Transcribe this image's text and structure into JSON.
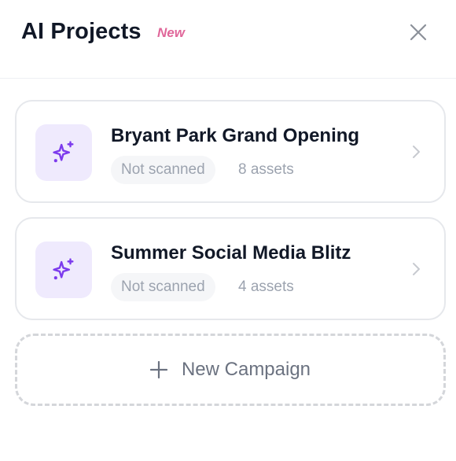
{
  "header": {
    "title": "AI Projects",
    "badge": "New",
    "close_icon": "close-icon"
  },
  "projects": [
    {
      "title": "Bryant Park Grand Opening",
      "status": "Not scanned",
      "assets": "8 assets",
      "icon": "sparkles-icon"
    },
    {
      "title": "Summer Social Media Blitz",
      "status": "Not scanned",
      "assets": "4 assets",
      "icon": "sparkles-icon"
    }
  ],
  "new_campaign": {
    "label": "New Campaign",
    "icon": "plus-icon"
  },
  "colors": {
    "accent": "#7c3aed",
    "icon_bg": "#efeafd",
    "badge": "#e0679a",
    "muted": "#9ca3af"
  }
}
